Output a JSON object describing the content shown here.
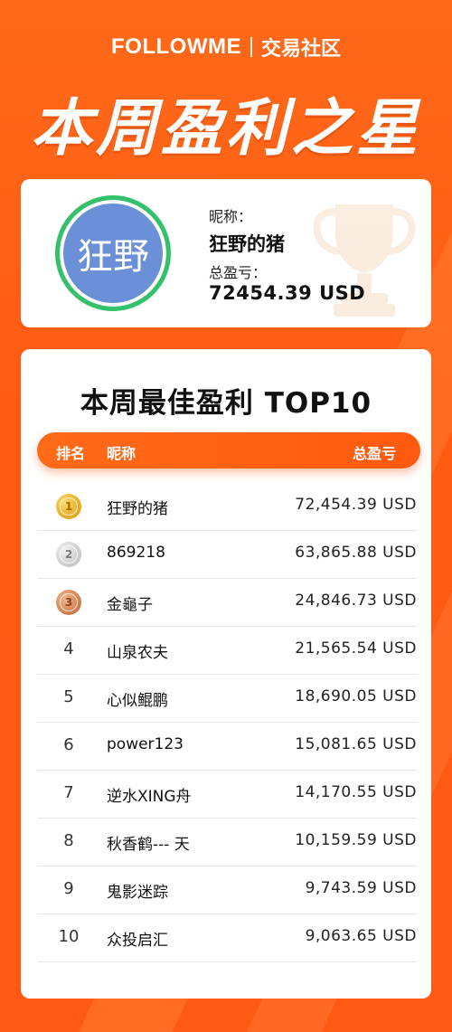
{
  "brand": {
    "logo_text": "FOLLOWME",
    "subtitle": "交易社区"
  },
  "hero": {
    "title": "本周盈利之星"
  },
  "winner": {
    "avatar_text": "狂野",
    "nickname_label": "昵称：",
    "nickname": "狂野的猪",
    "profit_label": "总盈亏：",
    "profit": "72454.39 USD"
  },
  "leaderboard": {
    "title": "本周最佳盈利 TOP10",
    "headers": {
      "rank": "排名",
      "nickname": "昵称",
      "total": "总盈亏"
    },
    "rows": [
      {
        "rank": "1",
        "medal": "gold",
        "name": "狂野的猪",
        "value": "72,454.39 USD"
      },
      {
        "rank": "2",
        "medal": "silver",
        "name": "869218",
        "value": "63,865.88 USD"
      },
      {
        "rank": "3",
        "medal": "bronze",
        "name": "金龜子",
        "value": "24,846.73 USD"
      },
      {
        "rank": "4",
        "medal": "",
        "name": "山泉农夫",
        "value": "21,565.54 USD"
      },
      {
        "rank": "5",
        "medal": "",
        "name": "心似鲲鹏",
        "value": "18,690.05 USD"
      },
      {
        "rank": "6",
        "medal": "",
        "name": "power123",
        "value": "15,081.65 USD"
      },
      {
        "rank": "7",
        "medal": "",
        "name": "逆水XING舟",
        "value": "14,170.55 USD"
      },
      {
        "rank": "8",
        "medal": "",
        "name": "秋香鹤--- 天",
        "value": "10,159.59 USD"
      },
      {
        "rank": "9",
        "medal": "",
        "name": "鬼影迷踪",
        "value": "9,743.59 USD"
      },
      {
        "rank": "10",
        "medal": "",
        "name": "众投启汇",
        "value": "9,063.65 USD"
      }
    ]
  },
  "colors": {
    "accent": "#ff5a12",
    "avatar_bg": "#6b90d8",
    "avatar_ring": "#33c16a"
  }
}
